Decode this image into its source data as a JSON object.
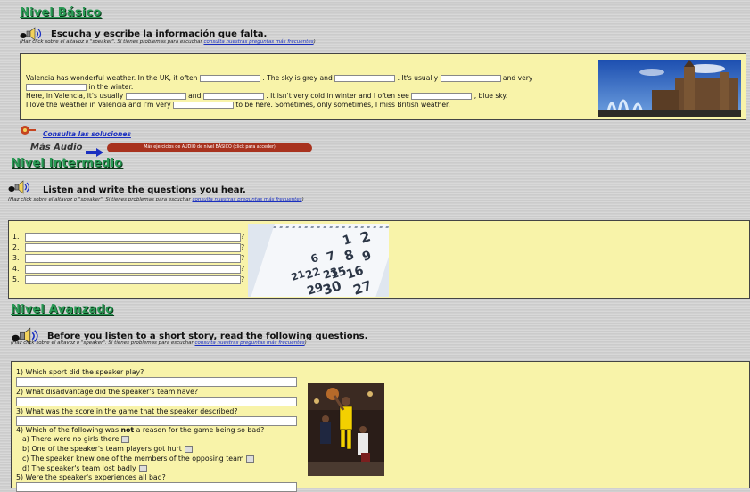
{
  "basico": {
    "heading": "Nivel Básico",
    "instruction": "Escucha y escribe la información que falta.",
    "help_prefix": "(Haz click sobre el altavoz o \"speaker\". Si tienes problemas para escuchar ",
    "help_link": "consulta nuestras preguntas más frecuentes",
    "help_suffix": ")",
    "text": {
      "l1a": "Valencia has wonderful weather. In the UK, it often",
      "l1b": ". The sky is grey and",
      "l1c": ". It's usually",
      "l1d": "and very",
      "l2": "in the winter.",
      "l3a": "Here, in Valencia, it's usually",
      "l3b": "and",
      "l3c": ". It isn't very cold in winter and I often see",
      "l3d": ", blue sky.",
      "l4a": "I love the weather in Valencia and I'm very",
      "l4b": "to be here. Sometimes, only sometimes, I miss British weather."
    },
    "solutions_link": "Consulta las soluciones",
    "mas_audio": "Más Audio",
    "mas_button": "Más ejercicios de AUDIO de nivel BÁSICO (click para acceder)"
  },
  "intermedio": {
    "heading": "Nivel Intermedio",
    "instruction": "Listen and write the questions you hear.",
    "help_prefix": "(Haz click sobre el altavoz o \"speaker\". Si tienes problemas para escuchar ",
    "help_link": "consulta nuestras preguntas más frecuentes",
    "help_suffix": ")",
    "rows": [
      "1.",
      "2.",
      "3.",
      "4.",
      "5."
    ],
    "qmark": "?"
  },
  "avanzado": {
    "heading": "Nivel Avanzado",
    "instruction": "Before you listen to a short story, read the following questions.",
    "help_prefix": "(Haz click sobre el altavoz o \"speaker\". Si tienes problemas para escuchar ",
    "help_link": "consulta nuestras preguntas más frecuentes",
    "help_suffix": ")",
    "q1": "1) Which sport did the speaker play?",
    "q2": "2) What disadvantage did the speaker's team have?",
    "q3": "3) What was the score in the game that the speaker described?",
    "q4a": "4) Which of the following was ",
    "q4b": "not",
    "q4c": " a reason for the game being so bad?",
    "opt_a": "a) There were no girls there",
    "opt_b": "b) One of the speaker's team players got hurt",
    "opt_c": "c) The speaker knew one of the members of the opposing team",
    "opt_d": "d) The speaker's team lost badly",
    "q5": "5) Were the speaker's experiences all bad?"
  },
  "calendar_numbers": [
    "2",
    "1",
    "8",
    "9",
    "7",
    "6",
    "16",
    "15",
    "23",
    "22",
    "21",
    "30",
    "29",
    "27"
  ],
  "colors": {
    "panel": "#f8f3a9",
    "heading": "#2a9a55",
    "link": "#1a2fc0",
    "button": "#a8321e"
  }
}
